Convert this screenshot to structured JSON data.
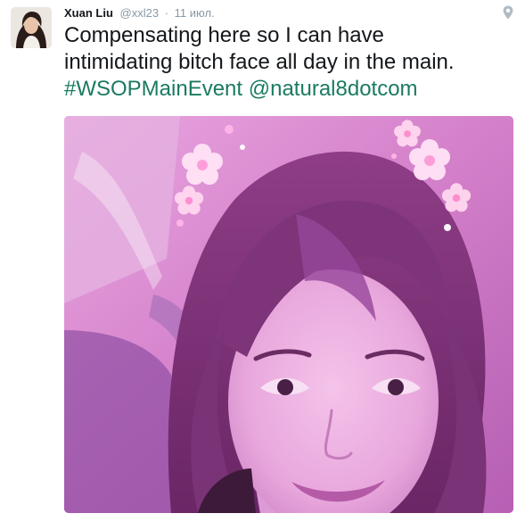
{
  "tweet": {
    "author_name": "Xuan Liu",
    "author_handle": "@xxl23",
    "separator": "·",
    "timestamp": "11 июл.",
    "text_line1": "Compensating here so I can have",
    "text_line2": "intimidating bitch face all day in the main.",
    "hashtag": "#WSOPMainEvent",
    "mention": "@natural8dotcom"
  },
  "icons": {
    "location": "location-pin-icon"
  },
  "colors": {
    "link": "#1b7a62",
    "meta": "#8899a6",
    "text": "#14171a",
    "media_tint": "#d783c8"
  }
}
